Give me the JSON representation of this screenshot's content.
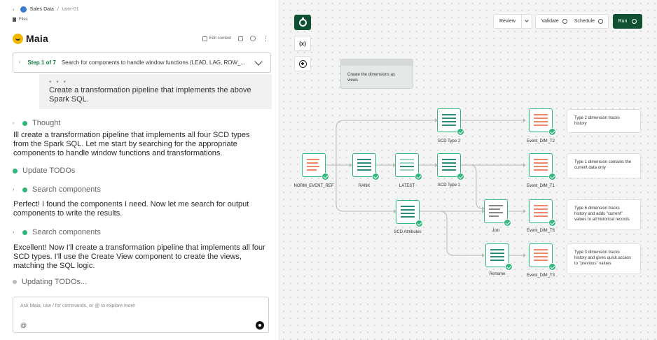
{
  "header": {
    "project": "Sales Data",
    "sep": "/",
    "user": "user-01",
    "files_label": "Files"
  },
  "assistant": {
    "name": "Maia",
    "edit_context_label": "Edit context"
  },
  "step": {
    "number": "Step 1 of 7",
    "text": "Search for components to handle window functions (LEAD, LAG, ROW_..."
  },
  "chat": {
    "user_message_fade": "• • •",
    "user_message": "Create a transformation pipeline that implements the above Spark SQL.",
    "thought_label": "Thought",
    "para1": "Ill create a transformation pipeline that implements all four SCD types from the Spark SQL. Let me start by searching for the appropriate components to handle window functions and transformations.",
    "update_todos": "Update TODOs",
    "search1": "Search components",
    "para2": "Perfect! I found the components I need. Now let me search for output components to write the results.",
    "search2": "Search components",
    "para3": "Excellent! Now I'll create a transformation pipeline that implements all four SCD types. I'll use the Create View component to create the views, matching the SQL logic.",
    "updating_todos": "Updating TODOs..."
  },
  "input": {
    "placeholder": "Ask Maia, use / for commands, or @ to explore more",
    "mention": "@"
  },
  "canvas": {
    "ctl_variables": "(x)",
    "toolbar": {
      "review": "Review",
      "validate": "Validate",
      "schedule": "Schedule",
      "run": "Run"
    },
    "note_text": "Create the dimensions as views",
    "nodes": {
      "norm_event_ref": "NORM_EVENT_REF",
      "rank": "RANK",
      "latest": "LATEST",
      "scd_type2": "SCD Type 2",
      "scd_type1": "SCD Type 1",
      "scd_attributes": "SCD Attributes",
      "join": "Join",
      "rename": "Rename",
      "event_dim_t2": "Event_DIM_T2",
      "event_dim_t1": "Event_DIM_T1",
      "event_dim_t6": "Event_DIM_T6",
      "event_dim_t3": "Event_DIM_T3"
    },
    "descriptions": {
      "t2": "Type 2 dimension tracks history",
      "t1": "Type 1 dimension contains the current data only",
      "t6": "Type 6 dimension tracks history and adds \"current\" values to all historical records",
      "t3": "Type 3 dimension tracks history and gives quick access to \"previous\" values"
    },
    "colors": {
      "accent": "#2fb67a",
      "primary": "#0f5132",
      "source_bars": "#f0876b",
      "transform_bars": "#2b8a78",
      "output_bars": "#f0876b"
    }
  }
}
